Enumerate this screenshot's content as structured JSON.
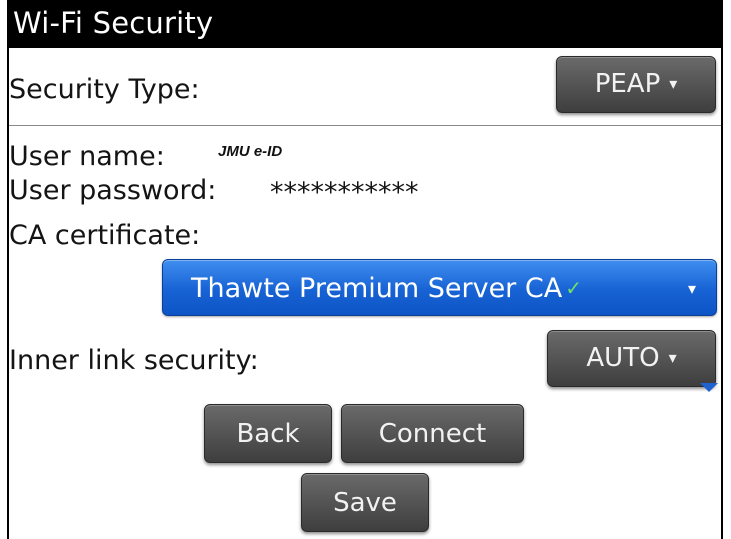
{
  "screen": {
    "title": "Wi-Fi Security"
  },
  "security_type": {
    "label": "Security Type:",
    "value": "PEAP"
  },
  "credentials": {
    "user_name_label": "User name:",
    "user_name_value": "JMU e-ID",
    "user_password_label": "User password:",
    "user_password_value": "***********"
  },
  "ca_certificate": {
    "label": "CA certificate:",
    "value": "Thawte Premium Server CA"
  },
  "inner_link_security": {
    "label": "Inner link security:",
    "value": "AUTO"
  },
  "buttons": {
    "back": "Back",
    "connect": "Connect",
    "save": "Save"
  },
  "icons": {
    "dropdown_caret": "▾",
    "check": "✓"
  },
  "colors": {
    "title_bar": "#000000",
    "dropdown_selected": "#1762d4",
    "button_dark": "#4e4e4e",
    "check": "#6fe06a"
  }
}
